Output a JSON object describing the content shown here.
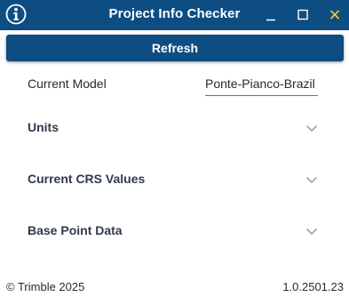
{
  "window": {
    "title": "Project Info Checker",
    "logo_icon": "info-badge-icon",
    "controls": [
      "minimize-icon",
      "maximize-icon",
      "close-icon"
    ],
    "accent_color": "#0d4d82",
    "close_color": "#f2d21b"
  },
  "toolbar": {
    "refresh_label": "Refresh"
  },
  "model": {
    "label": "Current Model",
    "value": "Ponte-Pianco-Brazil"
  },
  "sections": [
    {
      "title": "Units",
      "icon": "chevron-down-icon",
      "expanded": false
    },
    {
      "title": "Current CRS Values",
      "icon": "chevron-down-icon",
      "expanded": false
    },
    {
      "title": "Base Point Data",
      "icon": "chevron-down-icon",
      "expanded": false
    }
  ],
  "footer": {
    "copyright": "© Trimble 2025",
    "version": "1.0.2501.23"
  }
}
